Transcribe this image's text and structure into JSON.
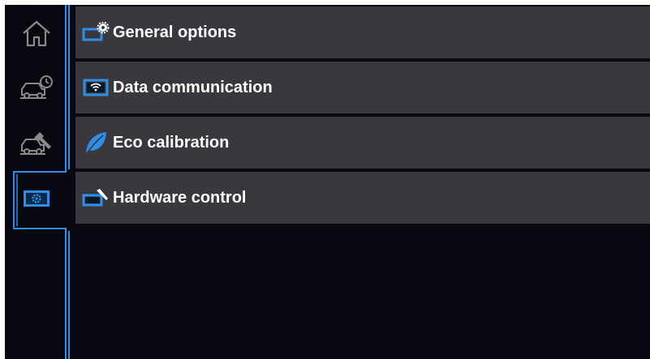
{
  "sidebar": {
    "items": [
      {
        "icon": "home-icon",
        "selected": false
      },
      {
        "icon": "car-diagnostic-clock-icon",
        "selected": false
      },
      {
        "icon": "car-service-wrench-icon",
        "selected": false
      },
      {
        "icon": "settings-icon",
        "selected": true
      }
    ]
  },
  "menu": {
    "items": [
      {
        "label": "General options",
        "icon": "general-options-gear-icon"
      },
      {
        "label": "Data communication",
        "icon": "data-communication-wifi-icon"
      },
      {
        "label": "Eco calibration",
        "icon": "eco-leaf-icon"
      },
      {
        "label": "Hardware control",
        "icon": "hardware-tool-icon"
      }
    ]
  },
  "colors": {
    "background": "#080810",
    "row": "#3a383d",
    "accent": "#2f8fe8",
    "text": "#ffffff",
    "icon_gray": "#8a8a8a"
  }
}
